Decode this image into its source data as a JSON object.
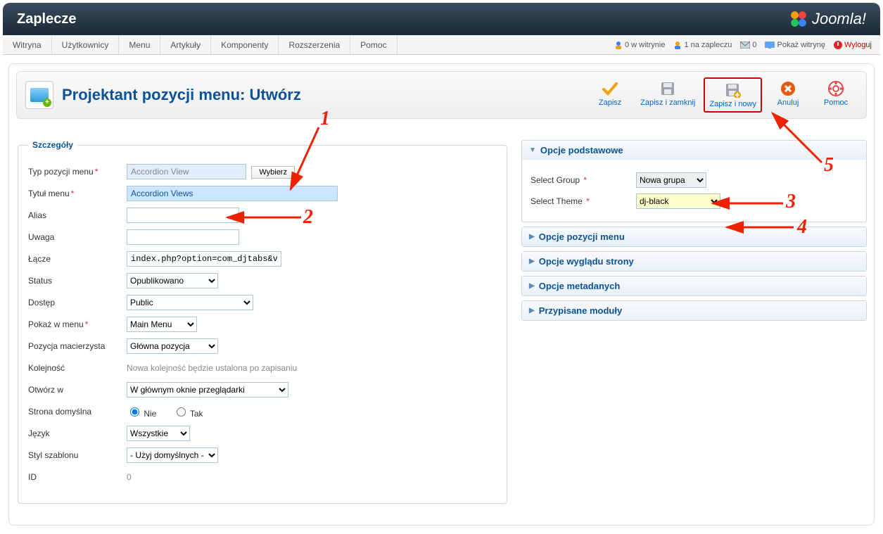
{
  "topbar": {
    "title": "Zaplecze",
    "brand": "Joomla!"
  },
  "menubar": {
    "items": [
      "Witryna",
      "Użytkownicy",
      "Menu",
      "Artykuły",
      "Komponenty",
      "Rozszerzenia",
      "Pomoc"
    ],
    "status": {
      "visitors": "0 w witrynie",
      "admins": "1 na zapleczu",
      "messages": "0",
      "view_site": "Pokaż witrynę",
      "logout": "Wyloguj"
    }
  },
  "page": {
    "title": "Projektant pozycji menu: Utwórz"
  },
  "toolbar": {
    "save": "Zapisz",
    "save_close": "Zapisz i zamknij",
    "save_new": "Zapisz i nowy",
    "cancel": "Anuluj",
    "help": "Pomoc"
  },
  "details": {
    "legend": "Szczegóły",
    "fields": {
      "type_label": "Typ pozycji menu",
      "type_value": "Accordion View",
      "type_button": "Wybierz",
      "title_label": "Tytuł menu",
      "title_value": "Accordion Views",
      "alias_label": "Alias",
      "alias_value": "",
      "note_label": "Uwaga",
      "note_value": "",
      "link_label": "Łącze",
      "link_value": "index.php?option=com_djtabs&view=tabs&lay",
      "status_label": "Status",
      "status_value": "Opublikowano",
      "access_label": "Dostęp",
      "access_value": "Public",
      "showin_label": "Pokaż w menu",
      "showin_value": "Main Menu",
      "parent_label": "Pozycja macierzysta",
      "parent_value": "Główna pozycja",
      "order_label": "Kolejność",
      "order_hint": "Nowa kolejność będzie ustalona po zapisaniu",
      "openin_label": "Otwórz w",
      "openin_value": "W głównym oknie przeglądarki",
      "default_label": "Strona domyślna",
      "default_no": "Nie",
      "default_yes": "Tak",
      "language_label": "Język",
      "language_value": "Wszystkie",
      "template_label": "Styl szablonu",
      "template_value": "- Użyj domyślnych -",
      "id_label": "ID",
      "id_value": "0"
    }
  },
  "right_panels": {
    "basic": {
      "header": "Opcje podstawowe",
      "group_label": "Select Group",
      "group_value": "Nowa grupa",
      "theme_label": "Select Theme",
      "theme_value": "dj-black"
    },
    "collapsed": [
      "Opcje pozycji menu",
      "Opcje wyglądu strony",
      "Opcje metadanych",
      "Przypisane moduły"
    ]
  },
  "annotations": {
    "n1": "1",
    "n2": "2",
    "n3": "3",
    "n4": "4",
    "n5": "5"
  }
}
